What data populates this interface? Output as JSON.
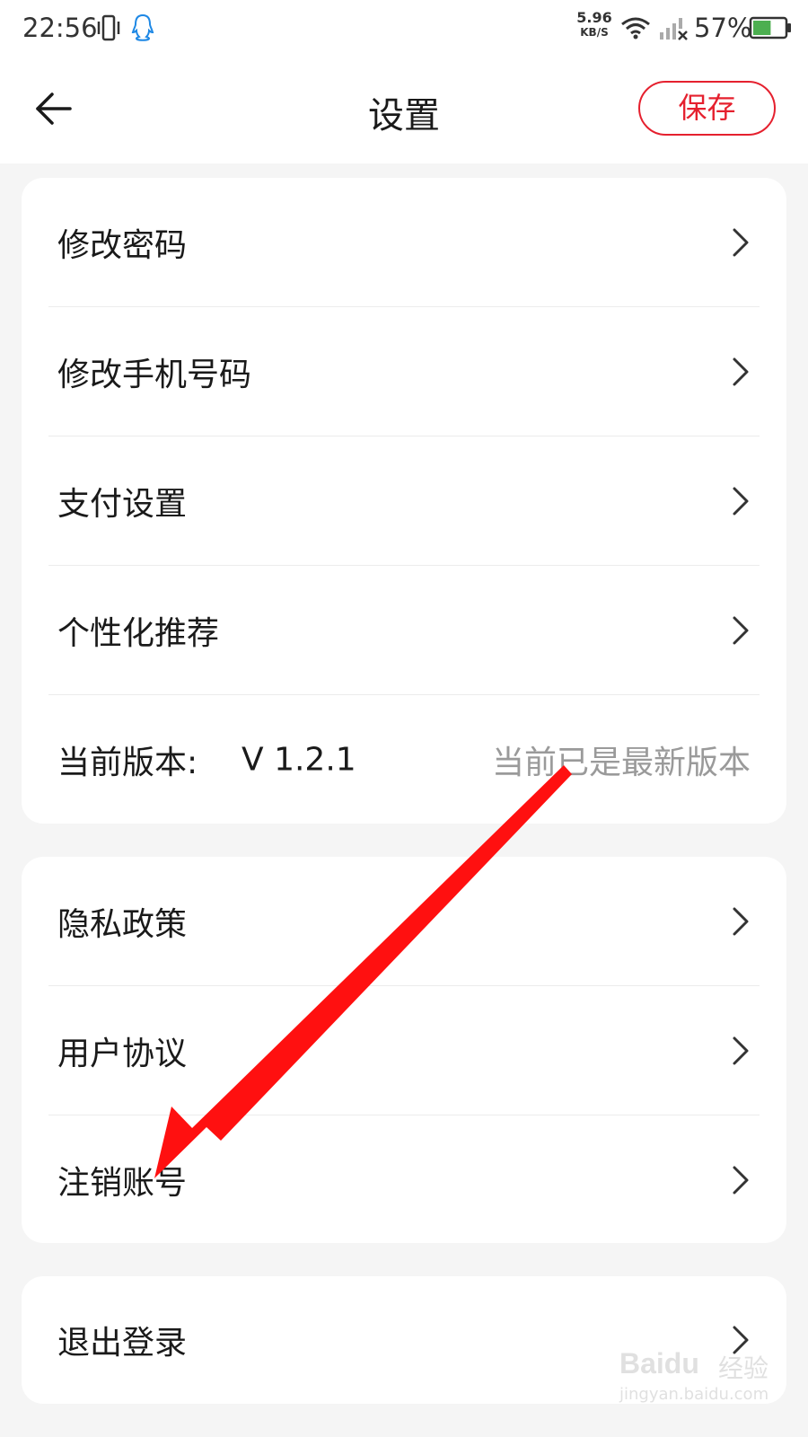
{
  "status_bar": {
    "time": "22:56",
    "net_speed_value": "5.96",
    "net_speed_unit": "KB/S",
    "battery_percent": "57%",
    "battery_level": 0.57,
    "icons": [
      "vibrate-icon",
      "qq-icon",
      "wifi-icon",
      "signal-off-icon",
      "battery-icon"
    ]
  },
  "header": {
    "title": "设置",
    "save_label": "保存",
    "accent_color": "#e5202e"
  },
  "section1": {
    "items": [
      {
        "label": "修改密码"
      },
      {
        "label": "修改手机号码"
      },
      {
        "label": "支付设置"
      },
      {
        "label": "个性化推荐"
      }
    ],
    "version": {
      "label": "当前版本:",
      "value": "V 1.2.1",
      "status": "当前已是最新版本"
    }
  },
  "section2": {
    "items": [
      {
        "label": "隐私政策"
      },
      {
        "label": "用户协议"
      },
      {
        "label": "注销账号"
      }
    ]
  },
  "section3": {
    "items": [
      {
        "label": "退出登录"
      }
    ]
  },
  "annotation": {
    "arrow_color": "#ff1010"
  },
  "watermark": {
    "brand": "Baidu",
    "brand_cn": "经验",
    "url": "jingyan.baidu.com"
  }
}
